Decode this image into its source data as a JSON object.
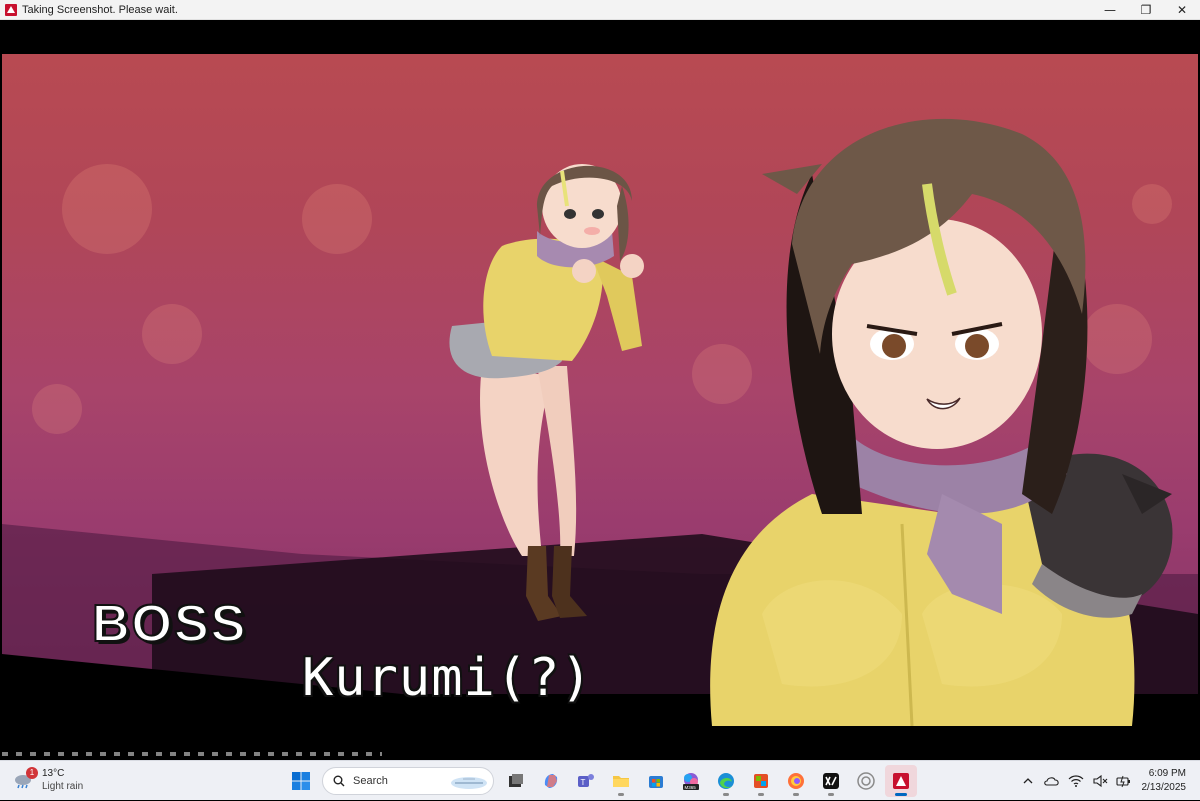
{
  "window": {
    "title": "Taking Screenshot. Please wait.",
    "controls": {
      "minimize": "—",
      "maximize": "❐",
      "close": "✕"
    }
  },
  "game": {
    "label": "BOSS",
    "name": "Kurumi(?)",
    "bg_color": "#b04658"
  },
  "taskbar": {
    "weather": {
      "temp": "13°C",
      "condition": "Light rain",
      "badge": "1"
    },
    "search_label": "Search",
    "apps": [
      "start-icon",
      "task-view-icon",
      "copilot-icon",
      "teams-icon",
      "file-explorer-icon",
      "store-icon",
      "m365-icon",
      "edge-icon",
      "photos-icon",
      "firefox-icon",
      "game-app-icon",
      "steam-icon",
      "rpg-maker-icon"
    ],
    "m365_text": "M365",
    "clock": {
      "time": "6:09 PM",
      "date": "2/13/2025"
    }
  }
}
